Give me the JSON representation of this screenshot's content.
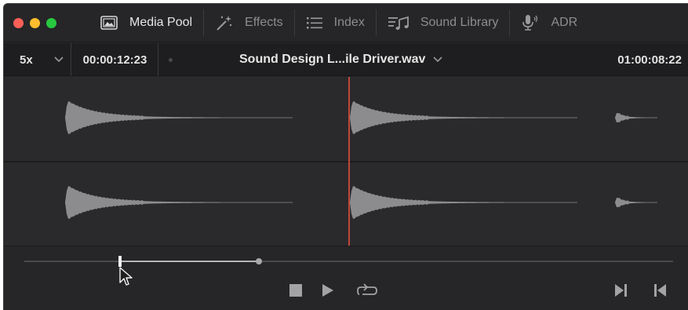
{
  "toolbar": {
    "items": [
      {
        "label": "Media Pool",
        "icon": "media-pool-icon",
        "active": true
      },
      {
        "label": "Effects",
        "icon": "effects-wand-icon",
        "active": false
      },
      {
        "label": "Index",
        "icon": "index-list-icon",
        "active": false
      },
      {
        "label": "Sound Library",
        "icon": "sound-library-icon",
        "active": false
      },
      {
        "label": "ADR",
        "icon": "microphone-icon",
        "active": false
      }
    ]
  },
  "header": {
    "zoom": "5x",
    "timecode_in": "00:00:12:23",
    "clip_name": "Sound Design L...ile Driver.wav",
    "timecode_out": "01:00:08:22"
  },
  "colors": {
    "playhead": "#c0473b",
    "waveform": "#8c8c8e",
    "background": "#28282a",
    "close": "#ff5f57",
    "minimize": "#febc2e",
    "maximize": "#28c840"
  },
  "transport": {
    "buttons": [
      "stop-icon",
      "play-icon",
      "loop-icon",
      "jump-to-end-icon",
      "jump-to-start-icon"
    ]
  }
}
